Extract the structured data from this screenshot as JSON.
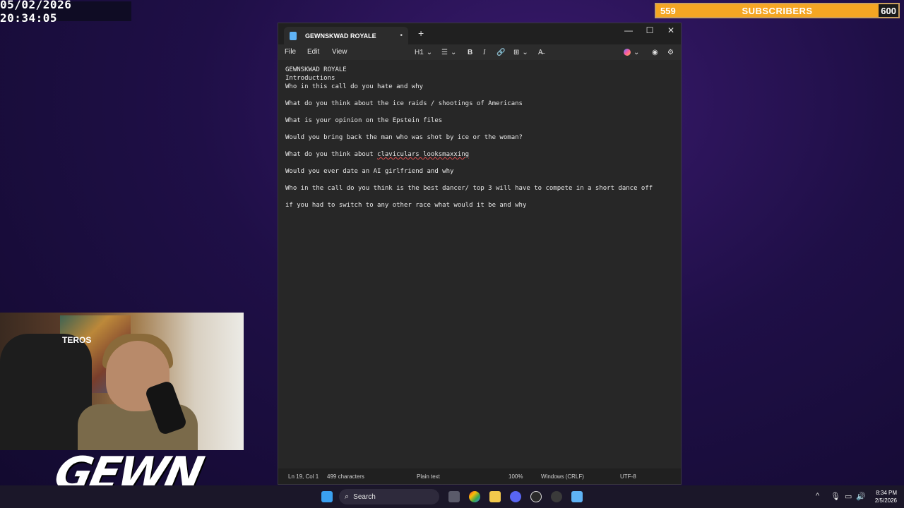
{
  "overlay": {
    "datetime": "05/02/2026 20:34:05",
    "subscribers": {
      "current": "559",
      "label": "SUBSCRIBERS",
      "goal": "600",
      "progress": 0.932
    }
  },
  "window": {
    "tab_title": "GEWNSKWAD ROYALE",
    "tab_unsaved_marker": "•",
    "new_tab": "+",
    "controls": {
      "minimize": "—",
      "maximize": "☐",
      "close": "✕"
    },
    "menu": {
      "file": "File",
      "edit": "Edit",
      "view": "View"
    },
    "toolbar": {
      "heading": "H1",
      "heading_caret": "⌄",
      "list": "☰",
      "list_caret": "⌄",
      "bold": "B",
      "italic": "I",
      "link": "🔗",
      "table": "⊞",
      "table_caret": "⌄",
      "clear_format": "A̶",
      "copilot_caret": "⌄",
      "account": "◉",
      "settings": "⚙"
    },
    "lines": [
      "GEWNSKWAD ROYALE",
      "Introductions",
      "Who in this call do you hate and why",
      "",
      "What do you think about the ice raids / shootings of Americans",
      "",
      "What is your opinion on the Epstein files",
      "",
      "Would you bring back the man who was shot by ice or the woman?",
      "",
      "What do you think about ",
      "",
      "Would you ever date an AI girlfriend and why",
      "",
      "Who in the call do you think is the best dancer/ top 3 will have to compete in a short dance off",
      "",
      "if you had to switch to any other race what would it be and why"
    ],
    "misspelled_phrase": "claviculars looksmaxxing",
    "status": {
      "position": "Ln 19, Col 1",
      "characters": "499 characters",
      "format": "Plain text",
      "zoom": "100%",
      "line_ending": "Windows (CRLF)",
      "encoding": "UTF-8"
    }
  },
  "webcam": {
    "chair_logo": "TEROS"
  },
  "brand_text": "GEWN",
  "taskbar": {
    "search_label": "Search",
    "time": "8:34 PM",
    "date": "2/5/2026",
    "tray": {
      "chevron": "^",
      "mic": "🎙",
      "display": "▭",
      "volume": "🔊"
    }
  },
  "colors": {
    "accent": "#f5a623",
    "window_bg": "#272727",
    "taskbar_bg": "#1b1729"
  }
}
